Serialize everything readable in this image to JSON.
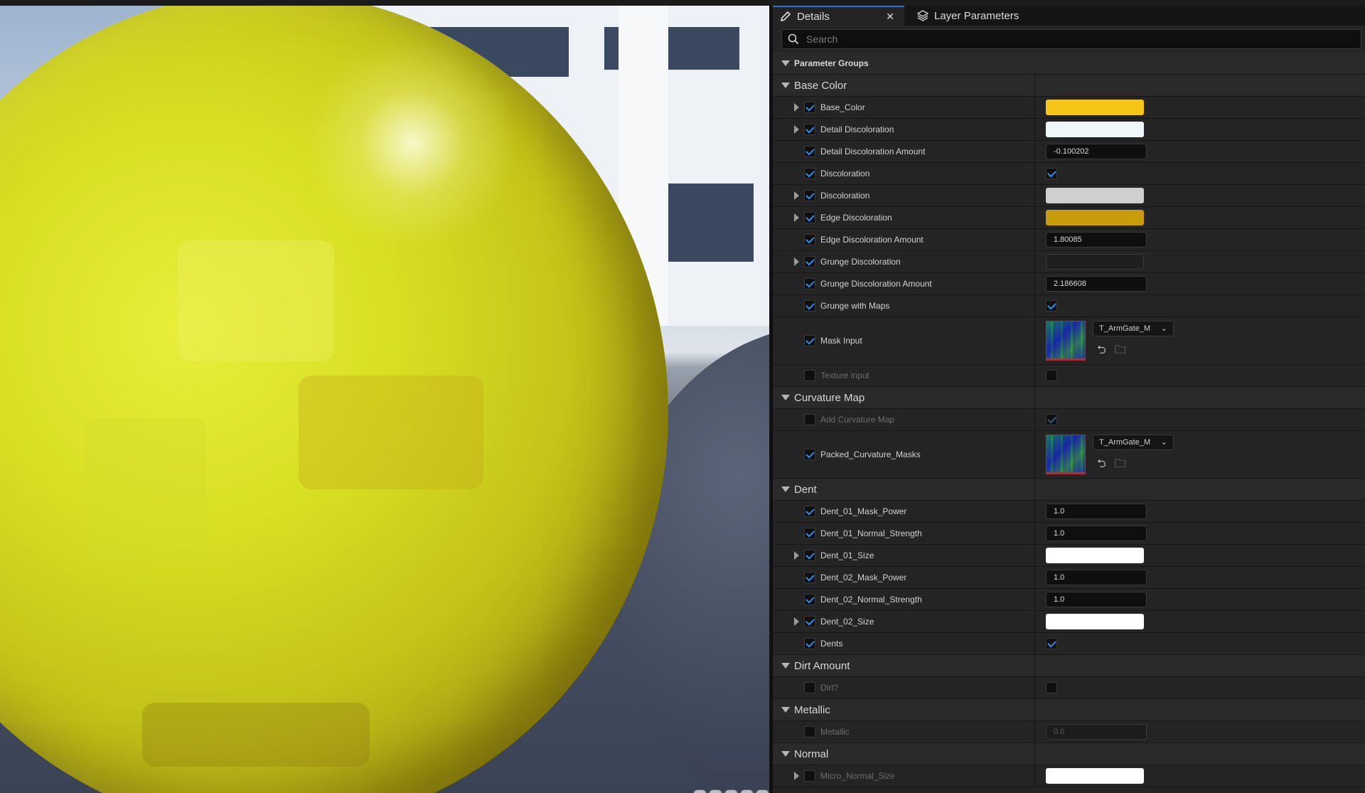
{
  "tabs": [
    {
      "label": "Details",
      "active": true
    },
    {
      "label": "Layer Parameters",
      "active": false
    }
  ],
  "search": {
    "placeholder": "Search"
  },
  "section": {
    "label": "Parameter Groups"
  },
  "groups": [
    {
      "label": "Base Color",
      "params": [
        {
          "label": "Base_Color",
          "expandable": true,
          "enabled": true,
          "type": "color",
          "color": "#f5c518"
        },
        {
          "label": "Detail Discoloration",
          "expandable": true,
          "enabled": true,
          "type": "color",
          "color": "#eef8fb"
        },
        {
          "label": "Detail Discoloration Amount",
          "expandable": false,
          "enabled": true,
          "type": "number",
          "value": "-0.100202"
        },
        {
          "label": "Discoloration",
          "expandable": false,
          "enabled": true,
          "type": "bool",
          "checked": true
        },
        {
          "label": "Discoloration",
          "expandable": true,
          "enabled": true,
          "type": "color",
          "color": "#cfcfcf"
        },
        {
          "label": "Edge Discoloration",
          "expandable": true,
          "enabled": true,
          "type": "color",
          "color": "#c99c0c"
        },
        {
          "label": "Edge Discoloration Amount",
          "expandable": false,
          "enabled": true,
          "type": "number",
          "value": "1.80085"
        },
        {
          "label": "Grunge Discoloration",
          "expandable": true,
          "enabled": true,
          "type": "color",
          "color": "#1f1f1f"
        },
        {
          "label": "Grunge Discoloration Amount",
          "expandable": false,
          "enabled": true,
          "type": "number",
          "value": "2.186608"
        },
        {
          "label": "Grunge with Maps",
          "expandable": false,
          "enabled": true,
          "type": "bool",
          "checked": true
        },
        {
          "label": "Mask Input",
          "expandable": false,
          "enabled": true,
          "type": "texture",
          "asset": "T_ArmGate_M"
        },
        {
          "label": "Texture input",
          "expandable": false,
          "enabled": false,
          "type": "bool",
          "checked": false
        }
      ]
    },
    {
      "label": "Curvature Map",
      "params": [
        {
          "label": "Add Curvature Map",
          "expandable": false,
          "enabled": false,
          "type": "bool",
          "checked": true
        },
        {
          "label": "Packed_Curvature_Masks",
          "expandable": false,
          "enabled": true,
          "type": "texture",
          "asset": "T_ArmGate_M"
        }
      ]
    },
    {
      "label": "Dent",
      "params": [
        {
          "label": "Dent_01_Mask_Power",
          "expandable": false,
          "enabled": true,
          "type": "number",
          "value": "1.0"
        },
        {
          "label": "Dent_01_Normal_Strength",
          "expandable": false,
          "enabled": true,
          "type": "number",
          "value": "1.0"
        },
        {
          "label": "Dent_01_Size",
          "expandable": true,
          "enabled": true,
          "type": "color",
          "color": "#ffffff"
        },
        {
          "label": "Dent_02_Mask_Power",
          "expandable": false,
          "enabled": true,
          "type": "number",
          "value": "1.0"
        },
        {
          "label": "Dent_02_Normal_Strength",
          "expandable": false,
          "enabled": true,
          "type": "number",
          "value": "1.0"
        },
        {
          "label": "Dent_02_Size",
          "expandable": true,
          "enabled": true,
          "type": "color",
          "color": "#ffffff"
        },
        {
          "label": "Dents",
          "expandable": false,
          "enabled": true,
          "type": "bool",
          "checked": true
        }
      ]
    },
    {
      "label": "Dirt Amount",
      "params": [
        {
          "label": "Dirt?",
          "expandable": false,
          "enabled": false,
          "type": "bool",
          "checked": false
        }
      ]
    },
    {
      "label": "Metallic",
      "params": [
        {
          "label": "Metallic",
          "expandable": false,
          "enabled": false,
          "type": "number",
          "value": "0.0"
        }
      ]
    },
    {
      "label": "Normal",
      "params": [
        {
          "label": "Micro_Normal_Size",
          "expandable": true,
          "enabled": false,
          "type": "color",
          "color": "#ffffff"
        }
      ]
    }
  ]
}
